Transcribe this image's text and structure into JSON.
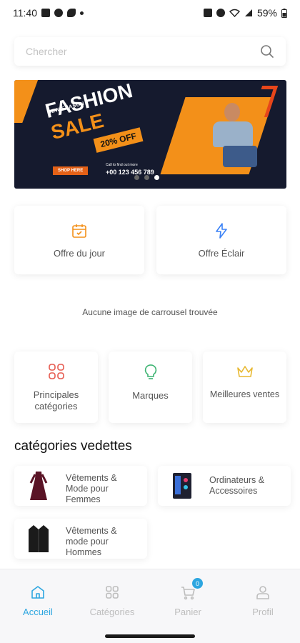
{
  "status_bar": {
    "time": "11:40",
    "battery": "59%"
  },
  "search": {
    "placeholder": "Chercher"
  },
  "banner": {
    "season": "NEW SEASON",
    "title": "FASHION",
    "subtitle": "SALE",
    "offer": "20% OFF",
    "shop_label": "SHOP HERE",
    "phone_caption": "Call to find out more",
    "phone": "+00 123 456 789"
  },
  "promo_cards": [
    {
      "label": "Offre du jour",
      "icon": "calendar-icon"
    },
    {
      "label": "Offre Éclair",
      "icon": "flash-icon"
    }
  ],
  "carousel_notice": "Aucune image de carrousel trouvée",
  "quick_links": [
    {
      "label": "Principales catégories",
      "icon": "grid-icon"
    },
    {
      "label": "Marques",
      "icon": "bulb-icon"
    },
    {
      "label": "Meilleures ventes",
      "icon": "crown-icon"
    }
  ],
  "featured": {
    "title": "catégories vedettes",
    "items": [
      {
        "label": "Vêtements & Mode pour Femmes",
        "icon": "dress-icon"
      },
      {
        "label": "Ordinateurs & Accessoires",
        "icon": "computer-icon"
      },
      {
        "label": "Vêtements & mode pour Hommes",
        "icon": "jacket-icon"
      }
    ]
  },
  "tabs": [
    {
      "label": "Accueil",
      "icon": "home-icon",
      "active": true
    },
    {
      "label": "Catégories",
      "icon": "categories-icon",
      "active": false
    },
    {
      "label": "Panier",
      "icon": "cart-icon",
      "active": false,
      "badge": "0"
    },
    {
      "label": "Profil",
      "icon": "profile-icon",
      "active": false
    }
  ],
  "colors": {
    "accent": "#2da6e0",
    "orange": "#f39019",
    "red_icon": "#e65a4f",
    "green_icon": "#3cb371",
    "gold_icon": "#e8b830",
    "flash_icon": "#3b82f6"
  }
}
